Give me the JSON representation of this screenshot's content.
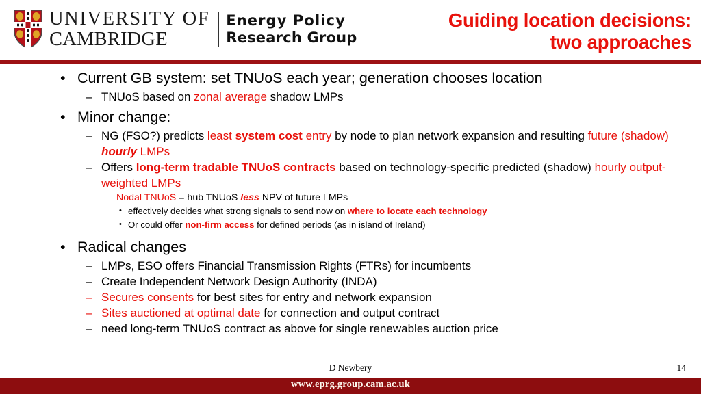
{
  "brand": {
    "crest_alt": "cambridge-crest",
    "university_line1": "UNIVERSITY OF",
    "university_line2": "CAMBRIDGE",
    "group_line1": "Energy Policy",
    "group_line2": "Research Group",
    "accent_red": "#e8120c",
    "bar_red": "#8d0d0f",
    "rule_red": "#9d1114"
  },
  "title": {
    "line1": "Guiding location decisions:",
    "line2": "two approaches"
  },
  "bullets": {
    "b1": {
      "marker": "•",
      "text": "Current GB system: set TNUoS each year; generation chooses location"
    },
    "b1s1": {
      "marker": "–",
      "seg1": "TNUoS based on ",
      "seg2_red": "zonal average",
      "seg3": " shadow LMPs"
    },
    "b2": {
      "marker": "•",
      "text": "Minor change:"
    },
    "b2s1": {
      "marker": "–",
      "seg1": "NG (FSO?) predicts ",
      "seg2_red": "least ",
      "seg3_red_bold": "system cost",
      "seg4_red": " entry",
      "seg5": " by node to plan network expansion and resulting ",
      "seg6_red": "future (shadow) ",
      "seg7_red_bold_italic": "hourly",
      "seg8_red": " LMPs"
    },
    "b2s2": {
      "marker": "–",
      "seg1": "Offers ",
      "seg2_red_bold": "long-term tradable TNUoS contracts",
      "seg3": " based on technology-specific predicted (shadow) ",
      "seg4_red": "hourly output-weighted LMPs"
    },
    "b2s3": {
      "seg1_red": "Nodal TNUoS",
      "seg2": " = hub TNUoS ",
      "seg3_red_bold_italic": "less",
      "seg4": " NPV of future LMPs"
    },
    "b2s4": {
      "marker": "•",
      "seg1": "effectively decides what strong signals to send now on ",
      "seg2_red_bold": "where to locate each technology"
    },
    "b2s5": {
      "marker": "•",
      "seg1": "Or could offer ",
      "seg2_red_bold": "non-firm access",
      "seg3": " for defined periods (as in island of Ireland)"
    },
    "b3": {
      "marker": "•",
      "text": "Radical changes"
    },
    "b3s1": {
      "marker": "–",
      "text": "LMPs, ESO offers Financial Transmission Rights (FTRs) for incumbents"
    },
    "b3s2": {
      "marker": "–",
      "text": "Create Independent Network Design Authority (INDA)"
    },
    "b3s3": {
      "marker": "–",
      "seg1_red": "Secures consents",
      "seg2": " for best sites for entry and network expansion"
    },
    "b3s4": {
      "marker": "–",
      "seg1_red": "Sites auctioned at optimal date",
      "seg2": " for connection and output contract"
    },
    "b3s5": {
      "marker": "–",
      "text": "need long-term TNUoS contract as above for single renewables auction price"
    }
  },
  "footer": {
    "author": "D Newbery",
    "page_number": "14",
    "url": "www.eprg.group.cam.ac.uk"
  }
}
